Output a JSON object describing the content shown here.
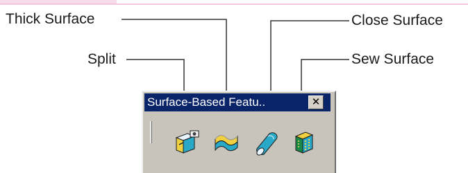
{
  "callouts": {
    "thick_surface": "Thick Surface",
    "close_surface": "Close Surface",
    "split": "Split",
    "sew_surface": "Sew Surface"
  },
  "toolbar": {
    "title": "Surface-Based Featu..",
    "close_glyph": "✕",
    "buttons": [
      {
        "name": "split",
        "icon": "split-icon"
      },
      {
        "name": "thick-surface",
        "icon": "thick-surface-icon"
      },
      {
        "name": "close-surface",
        "icon": "close-surface-icon"
      },
      {
        "name": "sew-surface",
        "icon": "sew-surface-icon"
      }
    ]
  },
  "colors": {
    "title_bar": "#0a246a",
    "toolbar_bg": "#c8c4bc",
    "accent_line": "#f2c6e0"
  }
}
